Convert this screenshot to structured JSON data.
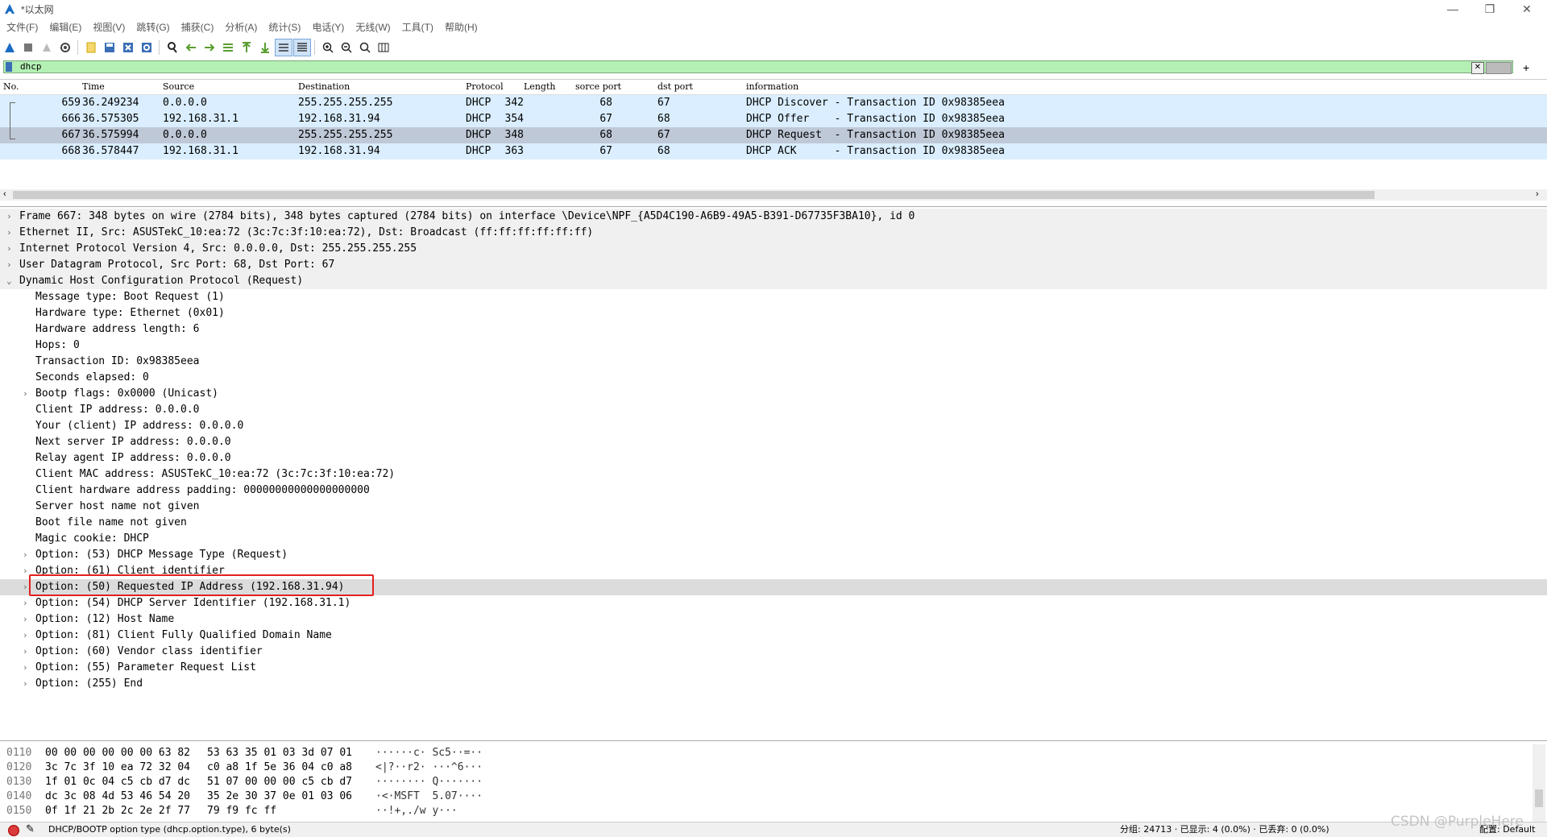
{
  "window": {
    "title": "*以太网",
    "minimize": "—",
    "restore": "❐",
    "close": "✕"
  },
  "menu": [
    "文件(F)",
    "编辑(E)",
    "视图(V)",
    "跳转(G)",
    "捕获(C)",
    "分析(A)",
    "统计(S)",
    "电话(Y)",
    "无线(W)",
    "工具(T)",
    "帮助(H)"
  ],
  "toolbar": {
    "icons": [
      "shark-start-icon",
      "stop-icon",
      "restart-icon",
      "options-icon",
      "open-file-icon",
      "save-icon",
      "close-file-icon",
      "reload-icon",
      "find-icon",
      "back-icon",
      "forward-icon",
      "go-to-packet-icon",
      "first-packet-icon",
      "last-packet-icon",
      "autoscroll-icon",
      "colorize-icon",
      "zoom-in-icon",
      "zoom-out-icon",
      "zoom-normal-icon",
      "resize-columns-icon"
    ],
    "accent": "#3a6fb7"
  },
  "filter": {
    "value": "dhcp",
    "apply_icon": "arrow-right-icon",
    "clear_icon": "clear-icon",
    "add": "+"
  },
  "packet_list": {
    "headers": [
      "No.",
      "Time",
      "Source",
      "Destination",
      "Protocol",
      "Length",
      "sorce port",
      "dst port",
      "information"
    ],
    "rows": [
      {
        "no": "659",
        "time": "36.249234",
        "src": "0.0.0.0",
        "dst": "255.255.255.255",
        "proto": "DHCP",
        "len": "342",
        "sport": "68",
        "dport": "67",
        "info": "DHCP Discover - Transaction ID 0x98385eea"
      },
      {
        "no": "666",
        "time": "36.575305",
        "src": "192.168.31.1",
        "dst": "192.168.31.94",
        "proto": "DHCP",
        "len": "354",
        "sport": "67",
        "dport": "68",
        "info": "DHCP Offer    - Transaction ID 0x98385eea"
      },
      {
        "no": "667",
        "time": "36.575994",
        "src": "0.0.0.0",
        "dst": "255.255.255.255",
        "proto": "DHCP",
        "len": "348",
        "sport": "68",
        "dport": "67",
        "info": "DHCP Request  - Transaction ID 0x98385eea"
      },
      {
        "no": "668",
        "time": "36.578447",
        "src": "192.168.31.1",
        "dst": "192.168.31.94",
        "proto": "DHCP",
        "len": "363",
        "sport": "67",
        "dport": "68",
        "info": "DHCP ACK      - Transaction ID 0x98385eea"
      }
    ],
    "row_color": "#daeeff",
    "selected_color": "#bfc8d6"
  },
  "details": [
    {
      "level": 0,
      "arrow": "›",
      "text": "Frame 667: 348 bytes on wire (2784 bits), 348 bytes captured (2784 bits) on interface \\Device\\NPF_{A5D4C190-A6B9-49A5-B391-D67735F3BA10}, id 0"
    },
    {
      "level": 0,
      "arrow": "›",
      "text": "Ethernet II, Src: ASUSTekC_10:ea:72 (3c:7c:3f:10:ea:72), Dst: Broadcast (ff:ff:ff:ff:ff:ff)"
    },
    {
      "level": 0,
      "arrow": "›",
      "text": "Internet Protocol Version 4, Src: 0.0.0.0, Dst: 255.255.255.255"
    },
    {
      "level": 0,
      "arrow": "›",
      "text": "User Datagram Protocol, Src Port: 68, Dst Port: 67"
    },
    {
      "level": 0,
      "arrow": "⌄",
      "text": "Dynamic Host Configuration Protocol (Request)"
    },
    {
      "level": 1,
      "arrow": "",
      "text": "Message type: Boot Request (1)"
    },
    {
      "level": 1,
      "arrow": "",
      "text": "Hardware type: Ethernet (0x01)"
    },
    {
      "level": 1,
      "arrow": "",
      "text": "Hardware address length: 6"
    },
    {
      "level": 1,
      "arrow": "",
      "text": "Hops: 0"
    },
    {
      "level": 1,
      "arrow": "",
      "text": "Transaction ID: 0x98385eea"
    },
    {
      "level": 1,
      "arrow": "",
      "text": "Seconds elapsed: 0"
    },
    {
      "level": 1,
      "arrow": "›",
      "text": "Bootp flags: 0x0000 (Unicast)"
    },
    {
      "level": 1,
      "arrow": "",
      "text": "Client IP address: 0.0.0.0"
    },
    {
      "level": 1,
      "arrow": "",
      "text": "Your (client) IP address: 0.0.0.0"
    },
    {
      "level": 1,
      "arrow": "",
      "text": "Next server IP address: 0.0.0.0"
    },
    {
      "level": 1,
      "arrow": "",
      "text": "Relay agent IP address: 0.0.0.0"
    },
    {
      "level": 1,
      "arrow": "",
      "text": "Client MAC address: ASUSTekC_10:ea:72 (3c:7c:3f:10:ea:72)"
    },
    {
      "level": 1,
      "arrow": "",
      "text": "Client hardware address padding: 00000000000000000000"
    },
    {
      "level": 1,
      "arrow": "",
      "text": "Server host name not given"
    },
    {
      "level": 1,
      "arrow": "",
      "text": "Boot file name not given"
    },
    {
      "level": 1,
      "arrow": "",
      "text": "Magic cookie: DHCP"
    },
    {
      "level": 1,
      "arrow": "›",
      "text": "Option: (53) DHCP Message Type (Request)"
    },
    {
      "level": 1,
      "arrow": "›",
      "text": "Option: (61) Client identifier"
    },
    {
      "level": 1,
      "arrow": "›",
      "text": "Option: (50) Requested IP Address (192.168.31.94)"
    },
    {
      "level": 1,
      "arrow": "›",
      "text": "Option: (54) DHCP Server Identifier (192.168.31.1)"
    },
    {
      "level": 1,
      "arrow": "›",
      "text": "Option: (12) Host Name"
    },
    {
      "level": 1,
      "arrow": "›",
      "text": "Option: (81) Client Fully Qualified Domain Name"
    },
    {
      "level": 1,
      "arrow": "›",
      "text": "Option: (60) Vendor class identifier"
    },
    {
      "level": 1,
      "arrow": "›",
      "text": "Option: (55) Parameter Request List"
    },
    {
      "level": 1,
      "arrow": "›",
      "text": "Option: (255) End"
    }
  ],
  "bytes": [
    {
      "off": "0110",
      "hex1": "00 00 00 00 00 00 63 82",
      "hex2": "53 63 35 01 03 3d 07 01",
      "asc": "······c· Sc5··=··"
    },
    {
      "off": "0120",
      "hex1": "3c 7c 3f 10 ea 72 32 04",
      "hex2": "c0 a8 1f 5e 36 04 c0 a8",
      "asc": "<|?··r2· ···^6···"
    },
    {
      "off": "0130",
      "hex1": "1f 01 0c 04 c5 cb d7 dc",
      "hex2": "51 07 00 00 00 c5 cb d7",
      "asc": "········ Q·······"
    },
    {
      "off": "0140",
      "hex1": "dc 3c 08 4d 53 46 54 20",
      "hex2": "35 2e 30 37 0e 01 03 06",
      "asc": "·<·MSFT  5.07····"
    },
    {
      "off": "0150",
      "hex1": "0f 1f 21 2b 2c 2e 2f 77",
      "hex2": "79 f9 fc ff",
      "asc": "··!+,./w y···"
    }
  ],
  "status": {
    "field": "DHCP/BOOTP option type (dhcp.option.type), 6 byte(s)",
    "packets": "分组: 24713 · 已显示: 4 (0.0%) · 已丢弃: 0 (0.0%)",
    "profile": "配置: Default"
  },
  "watermark": "CSDN @PurpleHere"
}
